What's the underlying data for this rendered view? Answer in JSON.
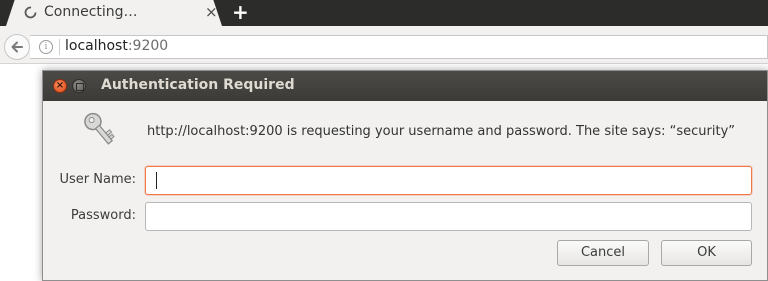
{
  "browser": {
    "tab": {
      "title": "Connecting…",
      "close_icon": "×",
      "spinner_icon": "loading-spinner"
    },
    "new_tab_label": "+",
    "toolbar": {
      "back_icon": "back-arrow",
      "info_icon_glyph": "i",
      "url_host": "localhost",
      "url_port": ":9200"
    }
  },
  "dialog": {
    "title": "Authentication Required",
    "close_glyph": "×",
    "icon": "key-icon",
    "message": "http://localhost:9200 is requesting your username and password. The site says: “security”",
    "username": {
      "label": "User Name:",
      "value": "",
      "placeholder": ""
    },
    "password": {
      "label": "Password:",
      "value": "",
      "placeholder": ""
    },
    "buttons": {
      "cancel": "Cancel",
      "ok": "OK"
    }
  },
  "colors": {
    "titlebar": "#3c3b37",
    "close_button": "#df4a16",
    "focus_border": "#f07746",
    "tabstrip": "#2c2c2a"
  }
}
